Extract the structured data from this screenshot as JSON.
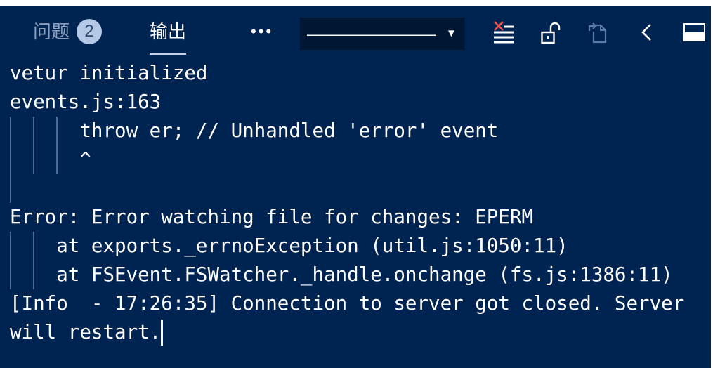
{
  "panel": {
    "tabs": [
      {
        "label": "问题",
        "badge": "2",
        "active": false
      },
      {
        "label": "输出",
        "active": true
      }
    ],
    "more_actions": {
      "icon": "more-actions-icon",
      "glyph": "•••"
    },
    "output_channel_select": {
      "selected_value": "————————",
      "arrow_icon": "chevron-down-icon",
      "arrow_glyph": "▼"
    },
    "actions": [
      {
        "icon": "clear-output-icon"
      },
      {
        "icon": "scroll-lock-icon",
        "locked": false
      },
      {
        "icon": "open-log-file-icon",
        "dimmed": true
      },
      {
        "icon": "chevron-left-icon"
      },
      {
        "icon": "maximize-panel-icon"
      }
    ]
  },
  "output": {
    "lines": [
      "vetur initialized",
      "events.js:163",
      "      throw er; // Unhandled 'error' event",
      "      ^",
      "",
      "Error: Error watching file for changes: EPERM",
      "    at exports._errnoException (util.js:1050:11)",
      "    at FSEvent.FSWatcher._handle.onchange (fs.js:1386:11)",
      "[Info  - 17:26:35] Connection to server got closed. Server",
      "will restart."
    ],
    "cursor_visible": true
  },
  "colors": {
    "panel_background": "#002451",
    "dropdown_background": "#001733",
    "foreground": "#ffffff",
    "inactive_tab": "#8d9fba",
    "badge_background": "#b3c9e5",
    "badge_foreground": "#2c4a70",
    "indent_guide": "#4d6a92",
    "clear_icon_x": "#e5534b",
    "dimmed_icon": "#5a7aa8"
  }
}
